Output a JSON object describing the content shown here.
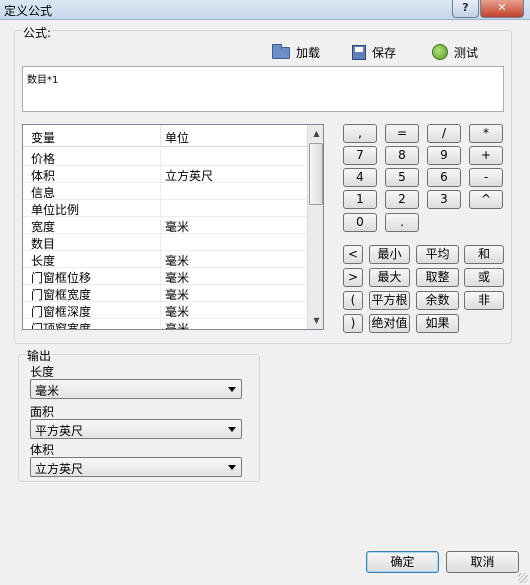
{
  "window": {
    "title": "定义公式",
    "help_label": "?",
    "close_label": "✕"
  },
  "formula_group": {
    "label": "公式:",
    "toolbar": {
      "load_label": "加载",
      "load_icon": "folder-icon",
      "save_label": "保存",
      "save_icon": "floppy-save-icon",
      "test_label": "测试",
      "test_icon": "test-icon"
    },
    "formula_value": "数目*1"
  },
  "variables_table": {
    "columns": [
      "变量",
      "单位"
    ],
    "rows": [
      {
        "name": "价格",
        "unit": ""
      },
      {
        "name": "体积",
        "unit": "立方英尺"
      },
      {
        "name": "信息",
        "unit": ""
      },
      {
        "name": "单位比例",
        "unit": ""
      },
      {
        "name": "宽度",
        "unit": "毫米"
      },
      {
        "name": "数目",
        "unit": ""
      },
      {
        "name": "长度",
        "unit": "毫米"
      },
      {
        "name": "门窗框位移",
        "unit": "毫米"
      },
      {
        "name": "门窗框宽度",
        "unit": "毫米"
      },
      {
        "name": "门窗框深度",
        "unit": "毫米"
      },
      {
        "name": "门顶窗宽度",
        "unit": "毫米"
      }
    ]
  },
  "keypad": {
    "row1": [
      ",",
      "=",
      "/",
      "*"
    ],
    "row2": [
      "7",
      "8",
      "9",
      "+"
    ],
    "row3": [
      "4",
      "5",
      "6",
      "-"
    ],
    "row4": [
      "1",
      "2",
      "3",
      "^"
    ],
    "row5": [
      "0",
      "."
    ],
    "func_row1": [
      "<",
      "最小",
      "平均",
      "和"
    ],
    "func_row2": [
      ">",
      "最大",
      "取整",
      "或"
    ],
    "func_row3": [
      "(",
      "平方根",
      "余数",
      "非"
    ],
    "func_row4": [
      ")",
      "绝对值",
      "如果"
    ]
  },
  "output_group": {
    "label": "输出",
    "length_label": "长度",
    "length_value": "毫米",
    "area_label": "面积",
    "area_value": "平方英尺",
    "volume_label": "体积",
    "volume_value": "立方英尺"
  },
  "dialog_buttons": {
    "ok_label": "确定",
    "cancel_label": "取消"
  }
}
